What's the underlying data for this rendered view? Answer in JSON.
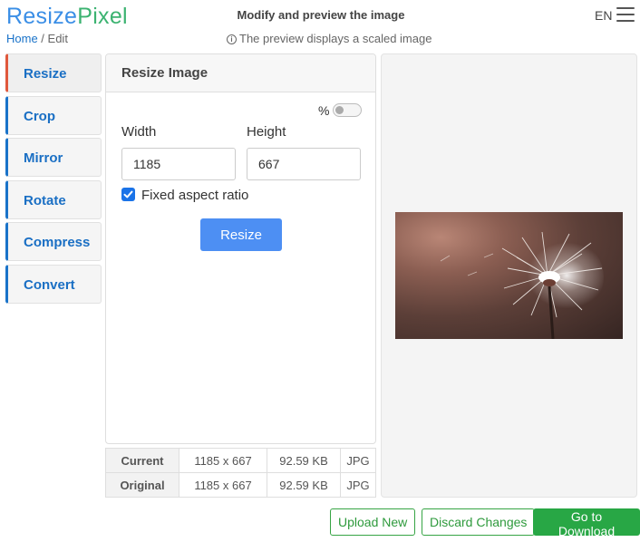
{
  "brand": {
    "part1": "Resize",
    "part2": "Pixel",
    "color1": "#3a8ee6",
    "color2": "#3cb371"
  },
  "breadcrumb": {
    "home": "Home",
    "separator": " / ",
    "current": "Edit"
  },
  "header": {
    "title": "Modify and preview the image",
    "preview_note": "The preview displays a scaled image",
    "language": "EN"
  },
  "sidebar": {
    "items": [
      {
        "label": "Resize",
        "active": true
      },
      {
        "label": "Crop"
      },
      {
        "label": "Mirror"
      },
      {
        "label": "Rotate"
      },
      {
        "label": "Compress"
      },
      {
        "label": "Convert"
      }
    ]
  },
  "panel": {
    "title": "Resize Image",
    "percent_label": "%",
    "percent_toggle_on": false,
    "width_label": "Width",
    "height_label": "Height",
    "width_value": "1185",
    "height_value": "667",
    "aspect_label": "Fixed aspect ratio",
    "aspect_checked": true,
    "resize_button": "Resize"
  },
  "info_table": {
    "rows": [
      {
        "label": "Current",
        "dimensions": "1185 x 667",
        "size": "92.59 KB",
        "format": "JPG"
      },
      {
        "label": "Original",
        "dimensions": "1185 x 667",
        "size": "92.59 KB",
        "format": "JPG"
      }
    ]
  },
  "actions": {
    "upload": "Upload New",
    "discard": "Discard Changes",
    "download": "Go to Download"
  },
  "colors": {
    "accent": "#1a73c9",
    "active_marker": "#e0583c",
    "primary_button": "#4d8ff3",
    "success": "#28a745"
  }
}
